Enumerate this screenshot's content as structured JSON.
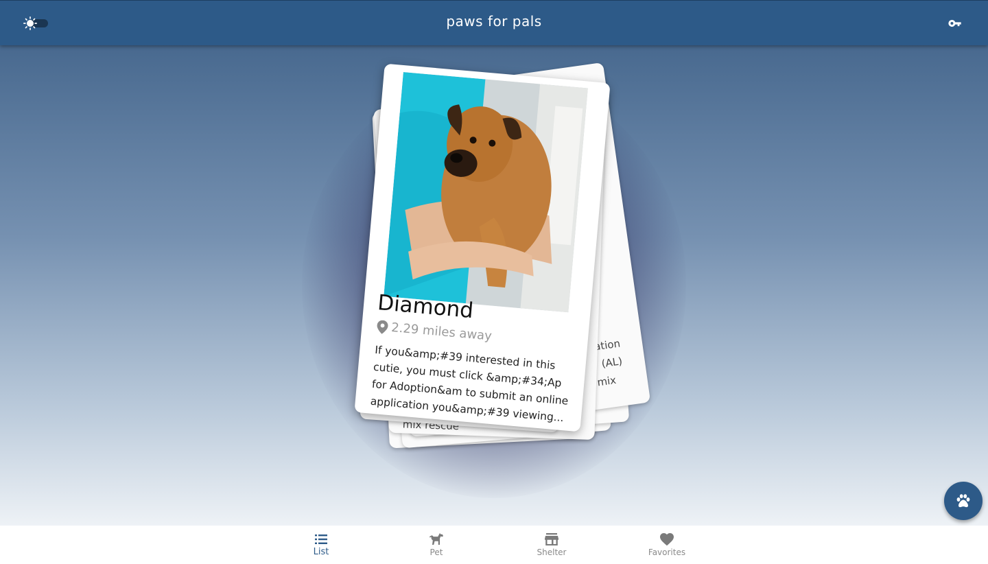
{
  "app": {
    "title": "paws for pals"
  },
  "header": {
    "theme_toggle_icon": "sun-icon",
    "login_icon": "key-icon"
  },
  "colors": {
    "primary": "#2d5a88",
    "nav_active": "#2d5a88",
    "nav_inactive": "#8a8a8a"
  },
  "pet_card": {
    "name": "Diamond",
    "distance": "2.29 miles away",
    "description": "If you&amp;#39 interested in this cutie, you must click &amp;#34;Ap for Adoption&am to submit an online application you&amp;#39 viewing... rescuea..."
  },
  "background_cards": {
    "snippets": [
      "ation",
      "(AL)",
      "mix",
      "mix rescue",
      "rescu"
    ]
  },
  "fab": {
    "icon": "paw-icon"
  },
  "bottom_nav": {
    "items": [
      {
        "label": "List",
        "icon": "list-icon",
        "active": true
      },
      {
        "label": "Pet",
        "icon": "dog-icon",
        "active": false
      },
      {
        "label": "Shelter",
        "icon": "store-icon",
        "active": false
      },
      {
        "label": "Favorites",
        "icon": "heart-icon",
        "active": false
      }
    ]
  }
}
